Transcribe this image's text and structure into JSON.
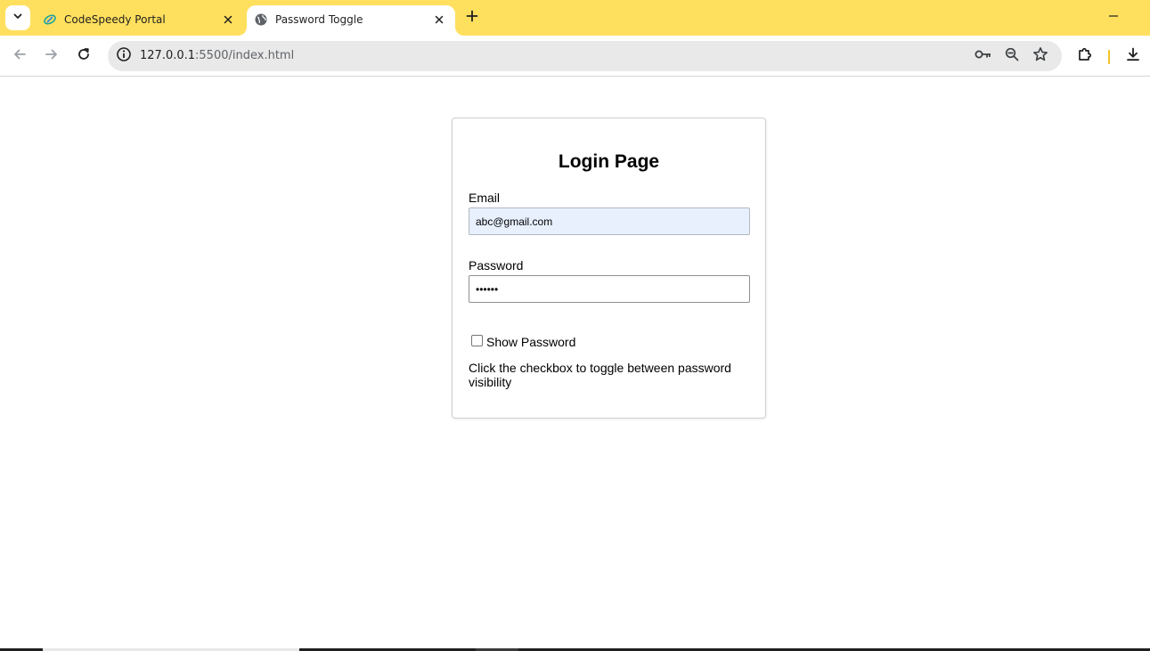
{
  "browser": {
    "tabs": [
      {
        "title": "CodeSpeedy Portal",
        "active": false
      },
      {
        "title": "Password Toggle",
        "active": true
      }
    ],
    "address": {
      "host": "127.0.0.1",
      "path": ":5500/index.html"
    },
    "accent_color": "#ffe05e"
  },
  "page": {
    "title": "Login Page",
    "email_label": "Email",
    "email_value": "abc@gmail.com",
    "password_label": "Password",
    "password_value": "••••••",
    "checkbox_label": "Show Password",
    "checkbox_checked": false,
    "hint": "Click the checkbox to toggle between password visibility"
  }
}
